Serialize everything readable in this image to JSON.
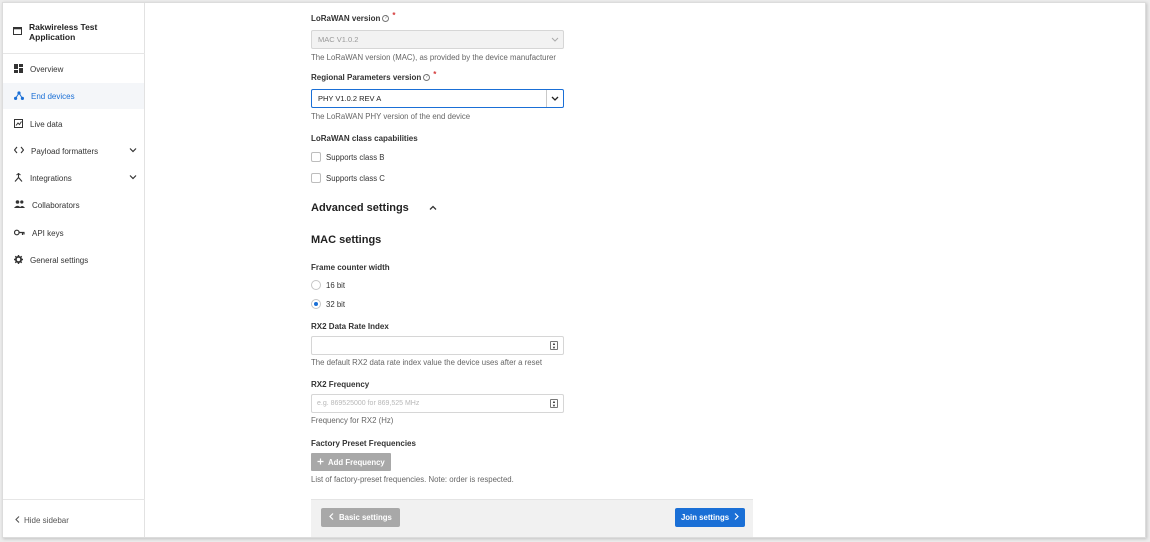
{
  "app": {
    "title": "Rakwireless Test Application",
    "icon": "window-icon"
  },
  "sidebar": {
    "items": [
      {
        "label": "Overview",
        "icon": "dashboard-icon"
      },
      {
        "label": "End devices",
        "icon": "devices-icon",
        "active": true
      },
      {
        "label": "Live data",
        "icon": "chart-icon"
      },
      {
        "label": "Payload formatters",
        "icon": "code-icon",
        "expandable": true
      },
      {
        "label": "Integrations",
        "icon": "integrations-icon",
        "expandable": true
      },
      {
        "label": "Collaborators",
        "icon": "people-icon"
      },
      {
        "label": "API keys",
        "icon": "key-icon"
      },
      {
        "label": "General settings",
        "icon": "gear-icon"
      }
    ],
    "hide_label": "Hide sidebar"
  },
  "form": {
    "lorawan_version": {
      "label": "LoRaWAN version",
      "value": "MAC V1.0.2",
      "hint": "The LoRaWAN version (MAC), as provided by the device manufacturer"
    },
    "regional_params": {
      "label": "Regional Parameters version",
      "value": "PHY V1.0.2 REV A",
      "hint": "The LoRaWAN PHY version of the end device"
    },
    "class_caps": {
      "label": "LoRaWAN class capabilities",
      "options": [
        {
          "label": "Supports class B",
          "checked": false
        },
        {
          "label": "Supports class C",
          "checked": false
        }
      ]
    },
    "advanced_heading": "Advanced settings",
    "mac_heading": "MAC settings",
    "frame_counter": {
      "label": "Frame counter width",
      "options": [
        {
          "label": "16 bit",
          "selected": false
        },
        {
          "label": "32 bit",
          "selected": true
        }
      ]
    },
    "rx2_dr": {
      "label": "RX2 Data Rate Index",
      "value": "",
      "hint": "The default RX2 data rate index value the device uses after a reset"
    },
    "rx2_freq": {
      "label": "RX2 Frequency",
      "placeholder": "e.g. 869525000 for 869,525 MHz",
      "hint": "Frequency for RX2 (Hz)"
    },
    "factory_freq": {
      "label": "Factory Preset Frequencies",
      "add_label": "Add Frequency",
      "hint": "List of factory-preset frequencies. Note: order is respected."
    }
  },
  "footer": {
    "back_label": "Basic settings",
    "next_label": "Join settings"
  },
  "colors": {
    "accent": "#1a6fd6",
    "required": "#d43b3b",
    "button_disabled": "#a8a8a8"
  }
}
